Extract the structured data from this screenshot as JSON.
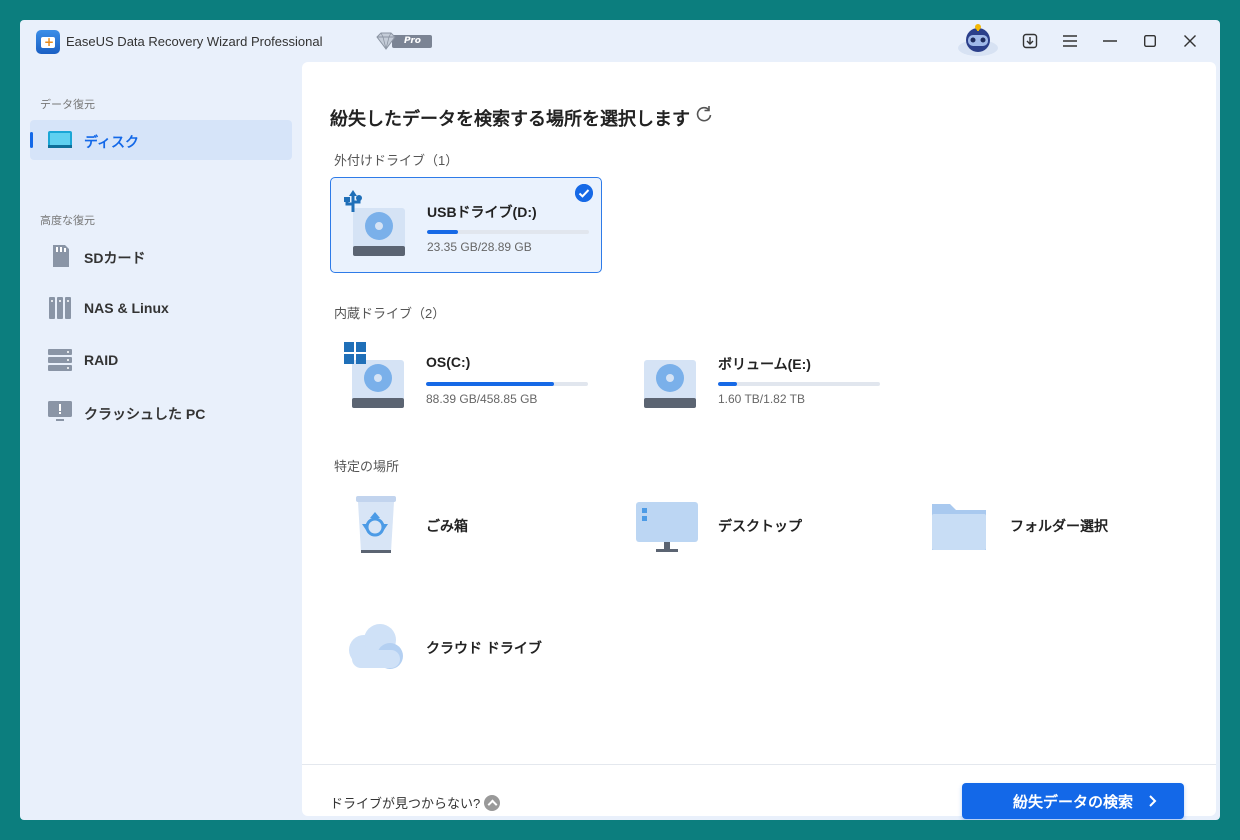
{
  "titlebar": {
    "app_title": "EaseUS Data Recovery Wizard Professional",
    "pro_label": "Pro",
    "icons": [
      "robot-mascot-icon",
      "download-icon",
      "menu-icon",
      "minimize-icon",
      "maximize-icon",
      "close-icon"
    ]
  },
  "sidebar": {
    "section_recovery": "データ復元",
    "section_advanced": "高度な復元",
    "items": [
      {
        "label": "ディスク",
        "icon": "disk-icon",
        "active": true
      },
      {
        "label": "SDカード",
        "icon": "sd-card-icon",
        "active": false
      },
      {
        "label": "NAS & Linux",
        "icon": "nas-icon",
        "active": false
      },
      {
        "label": "RAID",
        "icon": "raid-icon",
        "active": false
      },
      {
        "label": "クラッシュした PC",
        "icon": "crashed-pc-icon",
        "active": false
      }
    ]
  },
  "main": {
    "heading": "紛失したデータを検索する場所を選択します",
    "external_label": "外付けドライブ（1）",
    "internal_label": "内蔵ドライブ（2）",
    "specific_label": "特定の場所",
    "external_drives": [
      {
        "name": "USBドライブ(D:)",
        "size": "23.35 GB/28.89 GB",
        "usage": 0.19,
        "selected": true
      }
    ],
    "internal_drives": [
      {
        "name": "OS(C:)",
        "size": "88.39 GB/458.85 GB",
        "usage": 0.79
      },
      {
        "name": "ボリューム(E:)",
        "size": "1.60 TB/1.82 TB",
        "usage": 0.12
      }
    ],
    "locations": [
      {
        "name": "ごみ箱",
        "icon": "recycle-bin-icon"
      },
      {
        "name": "デスクトップ",
        "icon": "desktop-icon"
      },
      {
        "name": "フォルダー選択",
        "icon": "folder-icon"
      },
      {
        "name": "クラウド ドライブ",
        "icon": "cloud-icon"
      }
    ],
    "footer": {
      "help_text": "ドライブが見つからない?",
      "scan_button": "紛失データの検索"
    }
  },
  "colors": {
    "accent": "#1368e8",
    "background": "#0c7e7e",
    "sidebar": "#e9f0fb"
  }
}
